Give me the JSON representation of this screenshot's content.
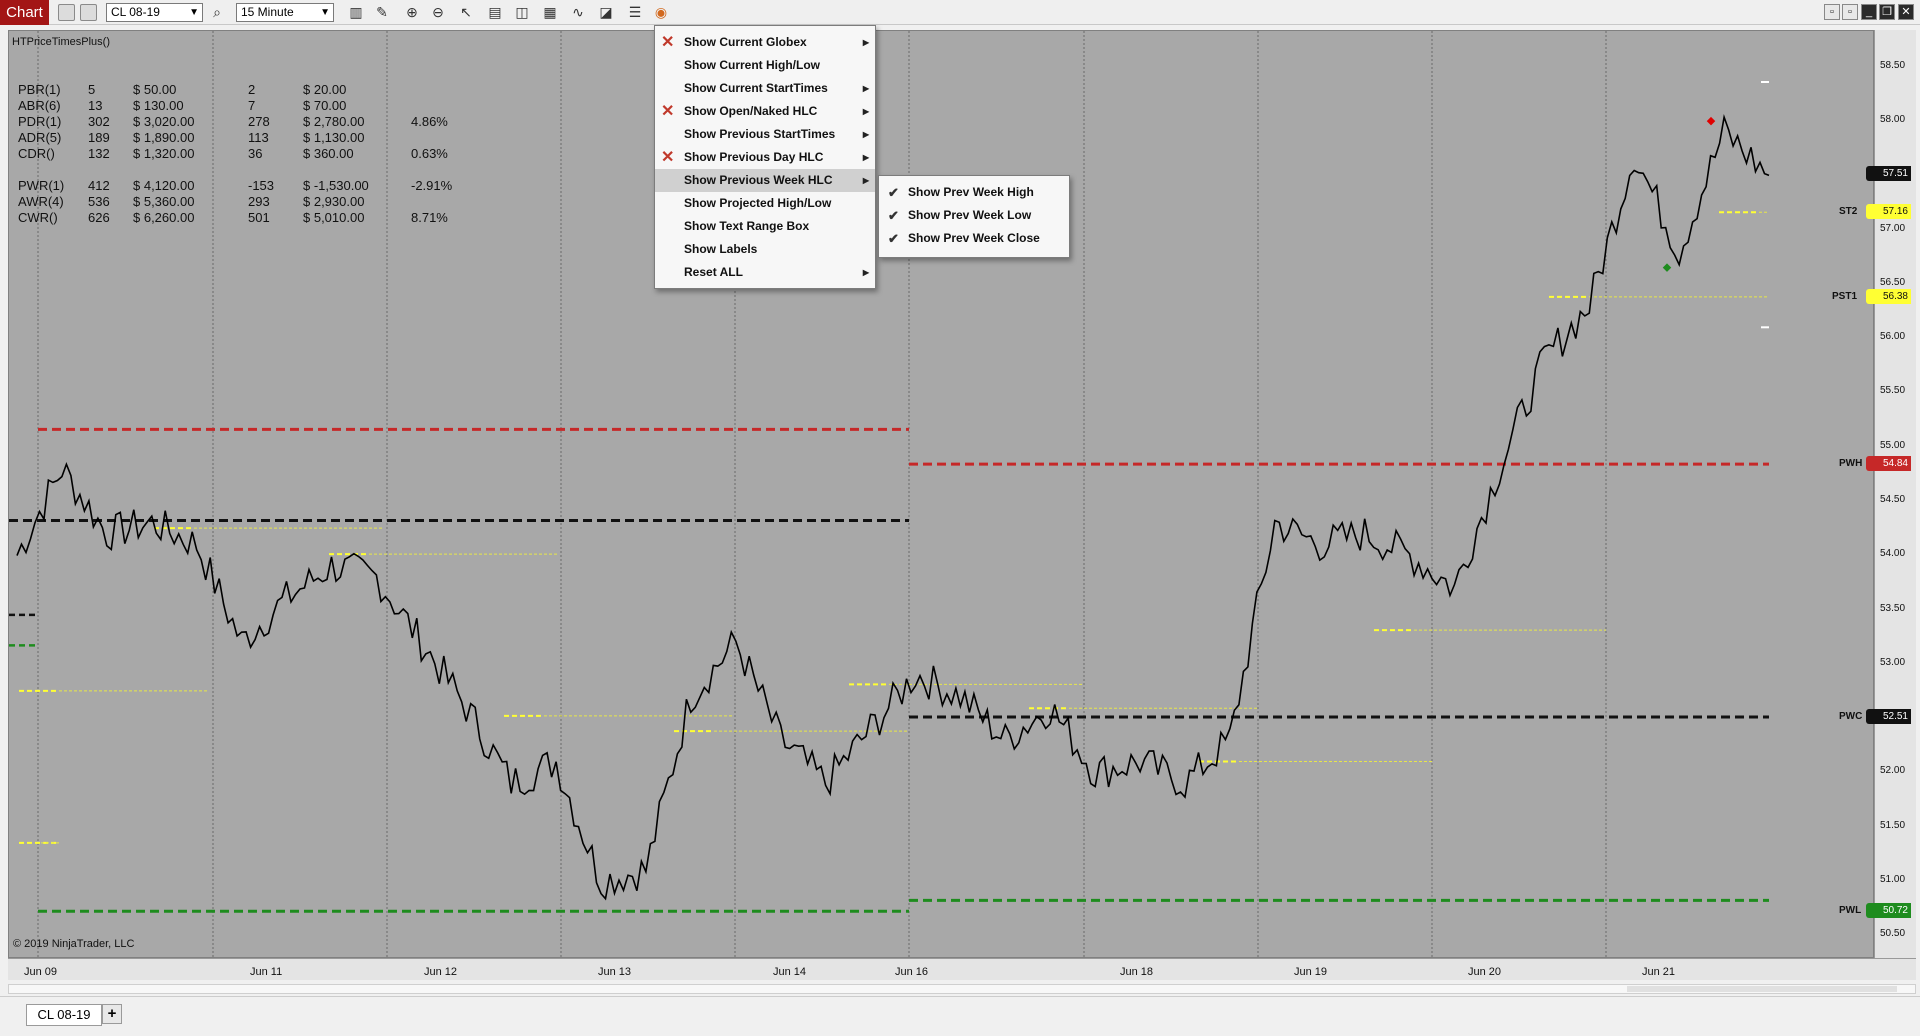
{
  "toolbar": {
    "chart_tab": "Chart",
    "instrument": "CL 08-19",
    "interval": "15 Minute",
    "icons": [
      "instrument-icon",
      "data-box-icon",
      "search-icon",
      "bar-type-icon",
      "drawing-tool-icon",
      "zoom-in-icon",
      "zoom-out-icon",
      "pointer-icon",
      "properties-icon",
      "templates-icon",
      "chart-trader-icon",
      "strategies-icon",
      "indicators-icon",
      "list-icon",
      "color-wheel-icon"
    ]
  },
  "indicator": {
    "name": "HTPriceTimesPlus()"
  },
  "stats": {
    "rows": [
      {
        "label": "PBR(1)",
        "n1": "5",
        "v1": "$    50.00",
        "n2": "2",
        "v2": "$    20.00",
        "pct": ""
      },
      {
        "label": "ABR(6)",
        "n1": "13",
        "v1": "$   130.00",
        "n2": "7",
        "v2": "$    70.00",
        "pct": ""
      },
      {
        "label": "PDR(1)",
        "n1": "302",
        "v1": "$ 3,020.00",
        "n2": "278",
        "v2": "$ 2,780.00",
        "pct": "4.86%"
      },
      {
        "label": "ADR(5)",
        "n1": "189",
        "v1": "$ 1,890.00",
        "n2": "113",
        "v2": "$ 1,130.00",
        "pct": ""
      },
      {
        "label": "CDR()",
        "n1": "132",
        "v1": "$ 1,320.00",
        "n2": "36",
        "v2": "$   360.00",
        "pct": "0.63%"
      },
      {
        "label": "PWR(1)",
        "n1": "412",
        "v1": "$ 4,120.00",
        "n2": "-153",
        "v2": "$ -1,530.00",
        "pct": "-2.91%"
      },
      {
        "label": "AWR(4)",
        "n1": "536",
        "v1": "$ 5,360.00",
        "n2": "293",
        "v2": "$ 2,930.00",
        "pct": ""
      },
      {
        "label": "CWR()",
        "n1": "626",
        "v1": "$ 6,260.00",
        "n2": "501",
        "v2": "$ 5,010.00",
        "pct": "8.71%"
      }
    ]
  },
  "context_menu": {
    "items": [
      {
        "label": "Show Current Globex",
        "x": true,
        "sub": true
      },
      {
        "label": "Show Current High/Low",
        "x": false,
        "sub": false
      },
      {
        "label": "Show Current StartTimes",
        "x": false,
        "sub": true
      },
      {
        "label": "Show Open/Naked HLC",
        "x": true,
        "sub": true
      },
      {
        "label": "Show Previous StartTimes",
        "x": false,
        "sub": true
      },
      {
        "label": "Show Previous Day HLC",
        "x": true,
        "sub": true
      },
      {
        "label": "Show Previous Week HLC",
        "x": false,
        "sub": true
      },
      {
        "label": "Show Projected High/Low",
        "x": false,
        "sub": false
      },
      {
        "label": "Show Text Range Box",
        "x": false,
        "sub": false
      },
      {
        "label": "Show Labels",
        "x": false,
        "sub": false
      },
      {
        "label": "Reset ALL",
        "x": false,
        "sub": true
      }
    ],
    "highlighted": "Show Previous Week HLC"
  },
  "submenu": {
    "items": [
      "Show Prev Week High",
      "Show Prev Week Low",
      "Show Prev Week Close"
    ]
  },
  "price_axis": {
    "ticks": [
      "58.50",
      "58.00",
      "57.50",
      "57.00",
      "56.50",
      "56.00",
      "55.50",
      "55.00",
      "54.50",
      "54.00",
      "53.50",
      "53.00",
      "52.50",
      "52.00",
      "51.50",
      "51.00",
      "50.50"
    ],
    "ylim": [
      50.28,
      58.83
    ]
  },
  "level_badges": [
    {
      "label": "",
      "value": "57.51",
      "color": "#111111",
      "text": "#ffffff"
    },
    {
      "label": "ST2",
      "value": "57.16",
      "color": "#ffff33",
      "text": "#111111"
    },
    {
      "label": "PST1",
      "value": "56.38",
      "color": "#ffff33",
      "text": "#111111"
    },
    {
      "label": "PWH",
      "value": "54.84",
      "color": "#c62828",
      "text": "#ffffff"
    },
    {
      "label": "PWC",
      "value": "52.51",
      "color": "#111111",
      "text": "#ffffff"
    },
    {
      "label": "PWL",
      "value": "50.72",
      "color": "#1e8c1e",
      "text": "#ffffff"
    }
  ],
  "time_axis": {
    "labels": [
      "Jun 09",
      "Jun 11",
      "Jun 12",
      "Jun 13",
      "Jun 14",
      "Jun 16",
      "Jun 18",
      "Jun 19",
      "Jun 20",
      "Jun 21"
    ]
  },
  "chart_data": {
    "type": "line",
    "instrument": "CL 08-19",
    "interval": "15 Minute",
    "series": [
      {
        "name": "CL 08-19",
        "x": [
          "Jun 09",
          "Jun 09",
          "Jun 09",
          "Jun 10",
          "Jun 10",
          "Jun 10",
          "Jun 11",
          "Jun 11",
          "Jun 11",
          "Jun 12",
          "Jun 12",
          "Jun 12",
          "Jun 12",
          "Jun 13",
          "Jun 13",
          "Jun 13",
          "Jun 13",
          "Jun 14",
          "Jun 14",
          "Jun 14",
          "Jun 16",
          "Jun 16",
          "Jun 17",
          "Jun 17",
          "Jun 17",
          "Jun 18",
          "Jun 18",
          "Jun 18",
          "Jun 18",
          "Jun 19",
          "Jun 19",
          "Jun 19",
          "Jun 19",
          "Jun 20",
          "Jun 20",
          "Jun 20",
          "Jun 20",
          "Jun 21",
          "Jun 21",
          "Jun 21"
        ],
        "values": [
          54.0,
          54.8,
          54.2,
          54.3,
          54.1,
          53.2,
          53.6,
          53.9,
          53.8,
          53.2,
          52.6,
          51.9,
          52.1,
          51.0,
          51.1,
          52.7,
          53.2,
          52.3,
          51.9,
          52.4,
          52.9,
          52.7,
          52.3,
          52.6,
          52.0,
          52.1,
          51.9,
          52.3,
          54.3,
          54.1,
          54.2,
          54.0,
          53.7,
          54.8,
          55.8,
          56.3,
          57.7,
          56.8,
          57.9,
          57.5
        ]
      }
    ],
    "levels": [
      {
        "name": "PWH",
        "value": 54.84
      },
      {
        "name": "PWC",
        "value": 52.51
      },
      {
        "name": "PWL",
        "value": 50.72
      }
    ],
    "ylim": [
      50.28,
      58.83
    ],
    "grid": true
  },
  "tabs": {
    "active": "CL 08-19",
    "add_label": "+"
  },
  "footer": {
    "copyright": "© 2019 NinjaTrader, LLC"
  }
}
